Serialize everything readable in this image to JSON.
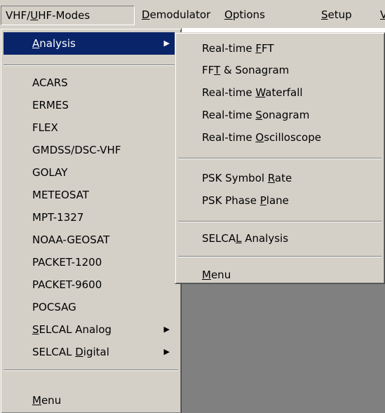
{
  "menubar": {
    "vhf_a": "VHF/",
    "vhf_u": "U",
    "vhf_b": "HF-Modes",
    "demod_u": "D",
    "demod_b": "emodulator",
    "options_u": "O",
    "options_b": "ptions",
    "setup_u": "S",
    "setup_b": "etup",
    "trunc_u": "V"
  },
  "main_menu": {
    "analysis_u": "A",
    "analysis_b": "nalysis",
    "arrow": "▶",
    "items": [
      "ACARS",
      "ERMES",
      "FLEX",
      "GMDSS/DSC-VHF",
      "GOLAY",
      "METEOSAT",
      "MPT-1327",
      "NOAA-GEOSAT",
      "PACKET-1200",
      "PACKET-9600",
      "POCSAG"
    ],
    "selcal_analog_u": "S",
    "selcal_analog_b": "ELCAL Analog",
    "selcal_digital_a": "SELCAL ",
    "selcal_digital_u": "D",
    "selcal_digital_b": "igital",
    "menu_u": "M",
    "menu_b": "enu"
  },
  "sub_menu": {
    "fft_a": "Real-time ",
    "fft_u": "F",
    "fft_b": "FT",
    "sona_a": "FF",
    "sona_u": "T",
    "sona_b": " & Sonagram",
    "water_a": "Real-time ",
    "water_u": "W",
    "water_b": "aterfall",
    "rtsona_a": "Real-time ",
    "rtsona_u": "S",
    "rtsona_b": "onagram",
    "osc_a": "Real-time ",
    "osc_u": "O",
    "osc_b": "scilloscope",
    "psk_rate_a": "PSK Symbol ",
    "psk_rate_u": "R",
    "psk_rate_b": "ate",
    "psk_phase_a": "PSK Phase ",
    "psk_phase_u": "P",
    "psk_phase_b": "lane",
    "selcal_a": "SELCA",
    "selcal_u": "L",
    "selcal_b": " Analysis",
    "menu_u": "M",
    "menu_b": "enu"
  }
}
